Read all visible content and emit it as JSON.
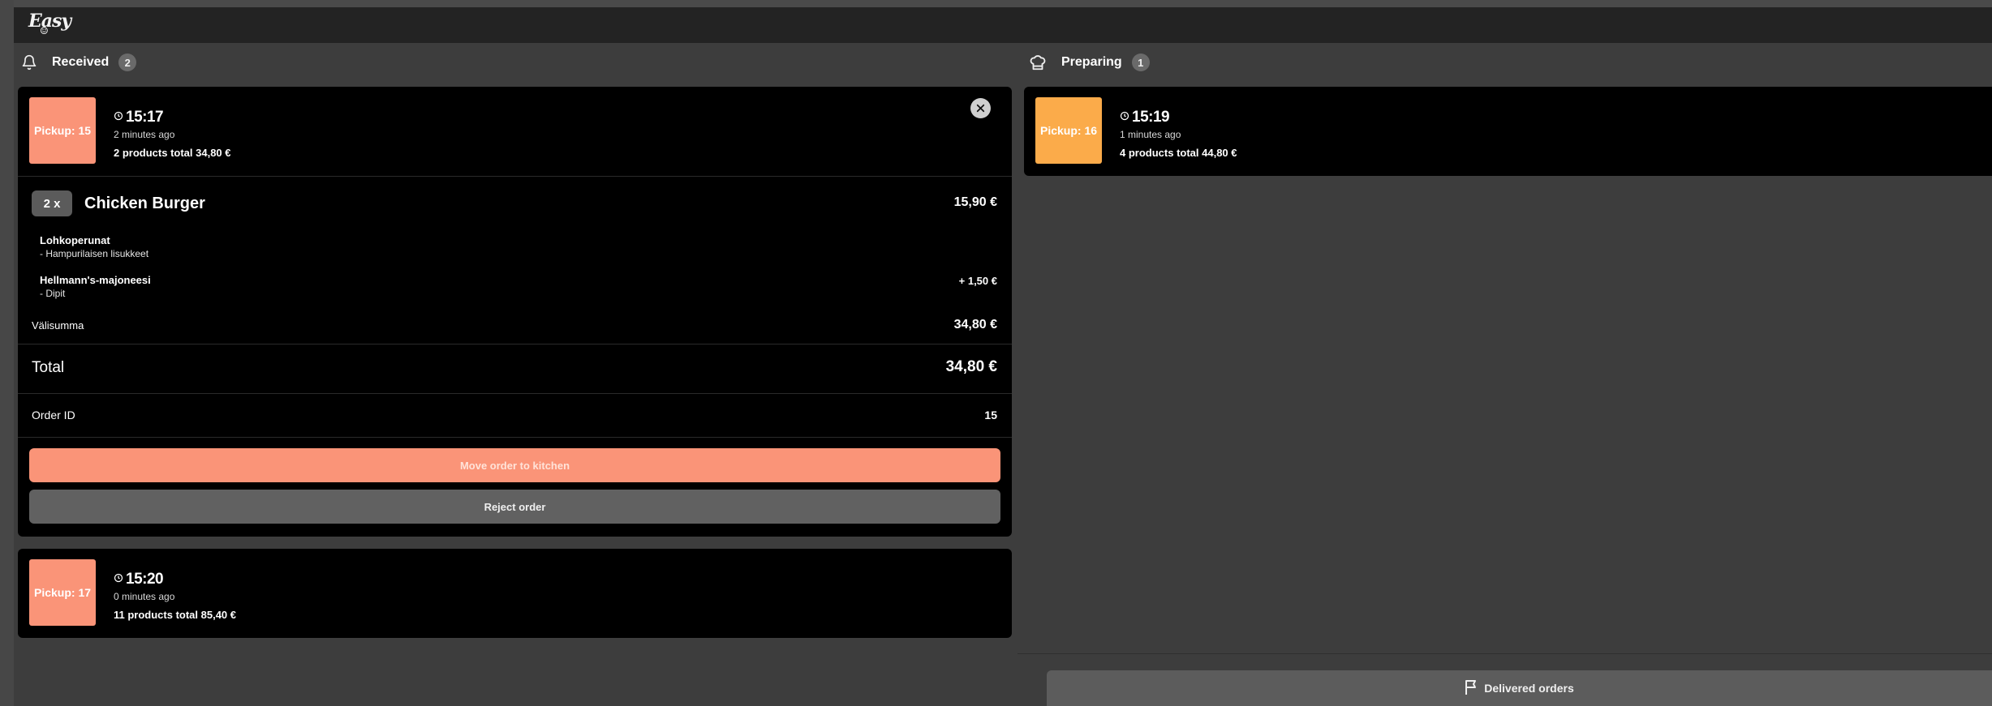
{
  "app": {
    "logo_text": "Easy"
  },
  "columns": {
    "received": {
      "title": "Received",
      "count": "2"
    },
    "preparing": {
      "title": "Preparing",
      "count": "1"
    }
  },
  "orders": {
    "expanded": {
      "pickup_label": "Pickup: 15",
      "time": "15:17",
      "ago": "2 minutes ago",
      "summary": "2 products total 34,80 €",
      "item": {
        "qty": "2 x",
        "name": "Chicken Burger",
        "price": "15,90 €"
      },
      "modifiers": [
        {
          "title": "Lohkoperunat",
          "sub": "- Hampurilaisen lisukkeet",
          "price": ""
        },
        {
          "title": "Hellmann's-majoneesi",
          "sub": "- Dipit",
          "price": "+ 1,50 €"
        }
      ],
      "subtotal_label": "Välisumma",
      "subtotal_value": "34,80 €",
      "total_label": "Total",
      "total_value": "34,80 €",
      "order_id_label": "Order ID",
      "order_id_value": "15",
      "move_button": "Move order to kitchen",
      "reject_button": "Reject order"
    },
    "received_second": {
      "pickup_label": "Pickup: 17",
      "time": "15:20",
      "ago": "0 minutes ago",
      "summary": "11 products total 85,40 €"
    },
    "preparing_first": {
      "pickup_label": "Pickup: 16",
      "time": "15:19",
      "ago": "1 minutes ago",
      "summary": "4 products total 44,80 €"
    }
  },
  "footer": {
    "delivered_button": "Delivered orders"
  },
  "colors": {
    "pickup_received": "#fa9478",
    "pickup_preparing": "#fbab4a",
    "primary_button": "#fa9478",
    "secondary_button": "#616161"
  },
  "icons": [
    "bell-icon",
    "chef-hat-icon",
    "clock-icon",
    "close-icon",
    "flag-icon"
  ]
}
